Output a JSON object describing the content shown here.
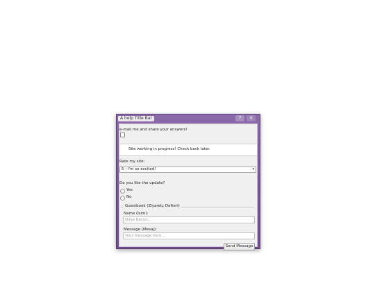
{
  "window": {
    "title": "A help Title Bar",
    "help_glyph": "?",
    "close_glyph": "×"
  },
  "form": {
    "email_label": "e-mail me and share your answers!",
    "notice_text": "Site working in progress! Check back later.",
    "rate_label": "Rate my site:",
    "rate_selected": "5 - I'm so excited!",
    "dropdown_arrow": "▾",
    "update_question": "Do you like the update?",
    "options": [
      "Yes",
      "No"
    ],
    "guestbook_legend": "Guestbook (Ziyaretç Defteri)",
    "name_label": "Name (İsim):",
    "name_placeholder": "Ninja Bacon...",
    "message_label": "Message (Mesaj):",
    "message_placeholder": "Your message here...",
    "send_button": "Send Message"
  }
}
